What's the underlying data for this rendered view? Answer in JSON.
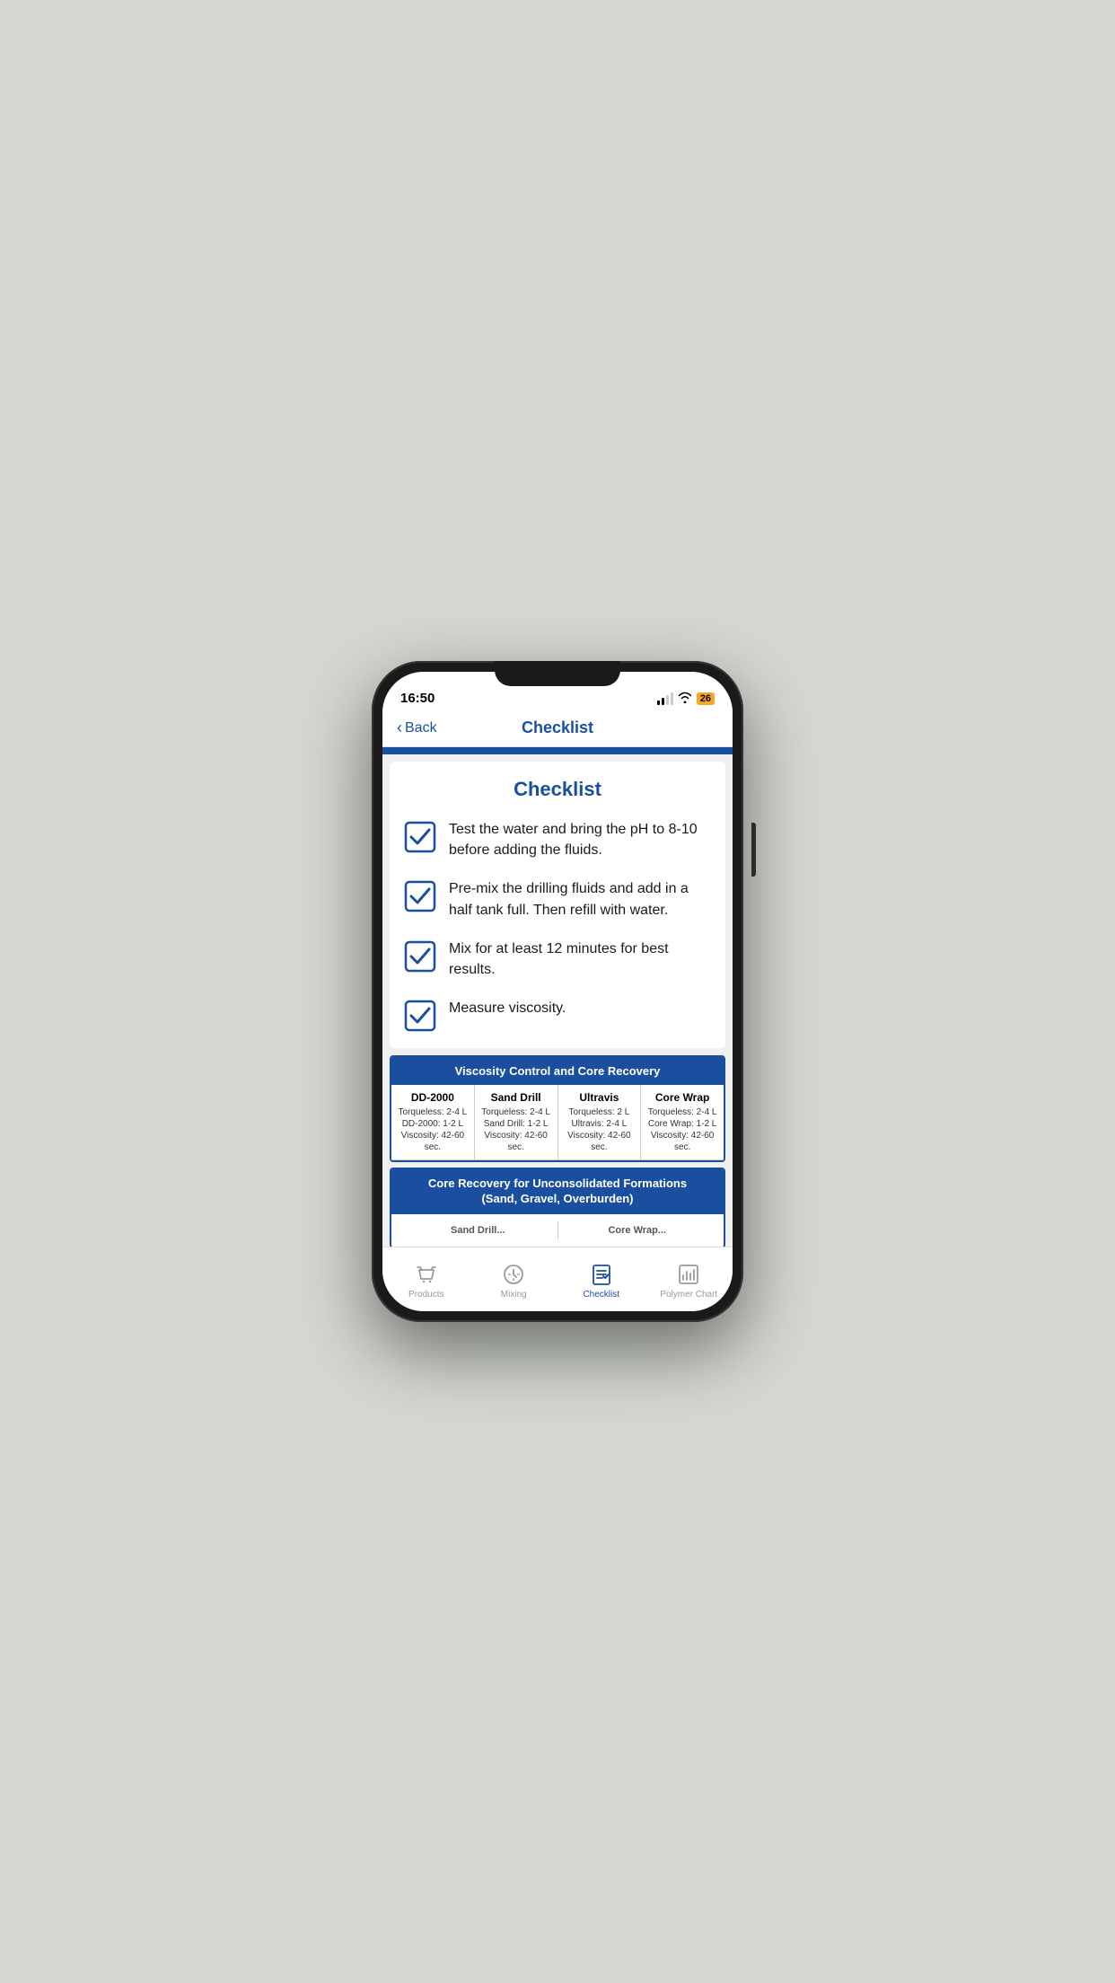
{
  "statusBar": {
    "time": "16:50",
    "battery": "26"
  },
  "header": {
    "backLabel": "Back",
    "title": "Checklist"
  },
  "checklist": {
    "title": "Checklist",
    "items": [
      {
        "id": 1,
        "text": "Test the water and bring the pH to 8-10 before adding the fluids."
      },
      {
        "id": 2,
        "text": "Pre-mix the drilling fluids and add in a half tank full. Then refill with water."
      },
      {
        "id": 3,
        "text": "Mix for at least 12 minutes for best results."
      },
      {
        "id": 4,
        "text": "Measure viscosity."
      }
    ]
  },
  "table1": {
    "title": "Viscosity Control and Core Recovery",
    "columns": [
      {
        "name": "DD-2000",
        "details": "Torqueless: 2-4 L\nDD-2000: 1-2 L\nViscosity: 42-60 sec."
      },
      {
        "name": "Sand Drill",
        "details": "Torqueless: 2-4 L\nSand Drill: 1-2 L\nViscosity: 42-60 sec."
      },
      {
        "name": "Ultravis",
        "details": "Torqueless: 2 L\nUltravis: 2-4 L\nViscosity: 42-60 sec."
      },
      {
        "name": "Core Wrap",
        "details": "Torqueless: 2-4 L\nCore Wrap: 1-2 L\nViscosity: 42-60 sec."
      }
    ]
  },
  "table2": {
    "title": "Core Recovery for Unconsolidated Formations\n(Sand, Gravel, Overburden)"
  },
  "bottomNav": {
    "tabs": [
      {
        "id": "products",
        "label": "Products",
        "icon": "basket",
        "active": false
      },
      {
        "id": "mixing",
        "label": "Mixing",
        "icon": "mixing",
        "active": false
      },
      {
        "id": "checklist",
        "label": "Checklist",
        "icon": "checklist",
        "active": true
      },
      {
        "id": "polymer-chart",
        "label": "Polymer Chart",
        "icon": "chart",
        "active": false
      }
    ]
  }
}
